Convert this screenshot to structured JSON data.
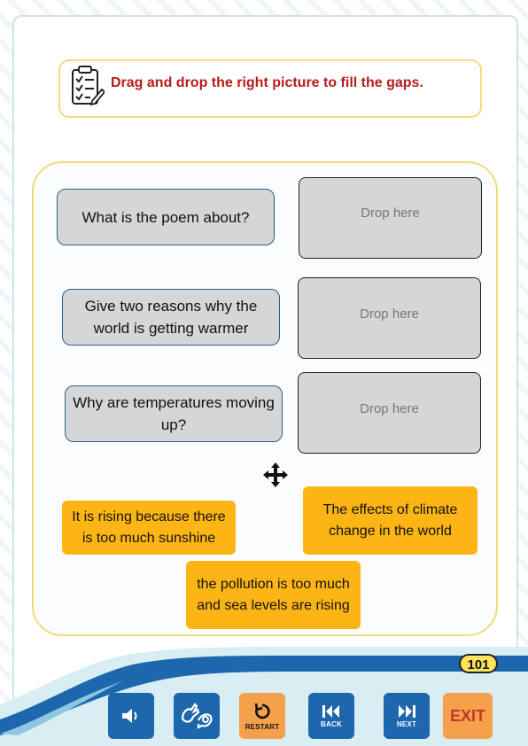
{
  "instruction": {
    "text": "Drag and drop the right picture to fill the gaps.",
    "icon": "clipboard-checklist-icon"
  },
  "questions": [
    {
      "text": "What is the poem about?"
    },
    {
      "text": "Give two reasons why the world is getting warmer"
    },
    {
      "text": "Why are temperatures moving up?"
    }
  ],
  "drop_zones": [
    {
      "placeholder": "Drop here"
    },
    {
      "placeholder": "Drop here"
    },
    {
      "placeholder": "Drop here"
    }
  ],
  "answers": [
    {
      "text": "It is rising because there is too much sunshine"
    },
    {
      "text": "The effects of climate change in the world"
    },
    {
      "text": "the pollution is too much and sea levels are rising"
    }
  ],
  "page_number": "101",
  "nav": {
    "sound_icon": "speaker-icon",
    "sign_icon": "sign-language-icon",
    "restart_label": "RESTART",
    "back_label": "BACK",
    "next_label": "NEXT",
    "exit_label": "EXIT"
  },
  "colors": {
    "accent_yellow": "#fdb515",
    "instruction_red": "#b71c1c",
    "nav_blue": "#1d67ad",
    "nav_orange": "#f5a04a",
    "border_yellow": "#f0dc7a"
  }
}
